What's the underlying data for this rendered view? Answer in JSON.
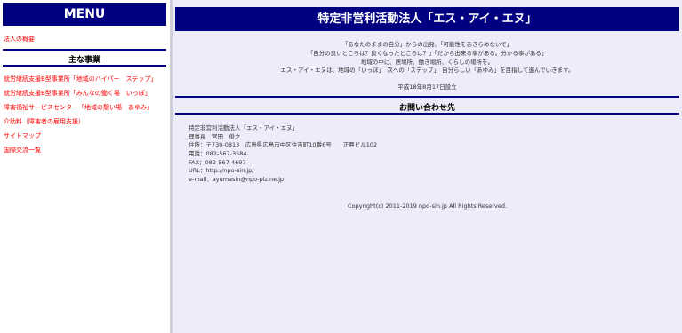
{
  "sidebar": {
    "menu_title": "MENU",
    "top_link": "法人の概要",
    "section_title": "主な事業",
    "items": [
      "就労継続支援B型事業所「地域のハイパー　ステップ」",
      "就労継続支援B型事業所「みんなの働く場　いっぽ」",
      "障害福祉サービスセンター「地域の憩い場　あゆみ」",
      "介助料（障害者の雇用支援）",
      "サイトマップ",
      "国際交流一覧"
    ]
  },
  "main": {
    "title": "特定非営利活動法人「エス・アイ・エヌ」",
    "intro_lines": [
      "「あなたのままの自分」からの出発、「可能性をあきらめないで」",
      "「自分の良いところは？良くなったところは？」「だから出来る事がある。分かる事がある」",
      "地域の中に、居場所、働き場所、くらしの場所を。",
      "エス・アイ・エヌは、地域の「いっぽ」　次への「ステップ」　自分らしい「あゆみ」を目指して進んでいきます。"
    ],
    "established": "平成18年8月17日設立"
  },
  "contact": {
    "heading": "お問い合わせ先",
    "lines": [
      "特定非営利活動法人「エス・アイ・エヌ」",
      "理事長　宮田　俊之",
      "住所：〒730-0813　広島県広島市中区住吉町10番6号　　正亜ビル102",
      "電話：082-567-3584",
      "FAX：082-567-4697",
      "URL：http://npo-sin.jp/",
      "e-mail：ayumasin@npo-plz.ne.jp"
    ]
  },
  "footer": {
    "copyright": "Copyright(c) 2011-2019 npo-sin.jp All Rights Reserved."
  }
}
